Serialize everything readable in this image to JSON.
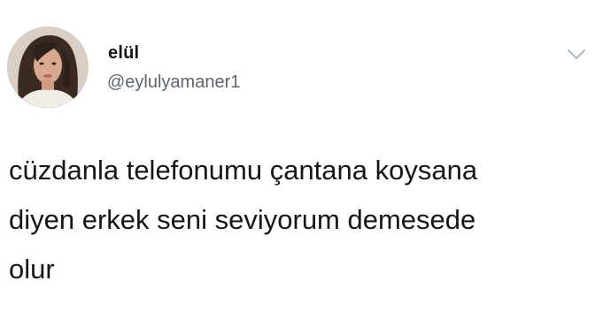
{
  "tweet": {
    "author": {
      "display_name": "elül",
      "handle": "@eylulyamaner1",
      "avatar_icon": "profile-photo"
    },
    "menu_icon": "chevron-down-icon",
    "text_lines": [
      "cüzdanla telefonumu çantana koysana",
      "diyen erkek seni seviyorum demesede",
      "olur"
    ]
  },
  "colors": {
    "text_primary": "#14171a",
    "text_secondary": "#5b6670",
    "chevron": "#aab8c2",
    "background": "#ffffff"
  }
}
